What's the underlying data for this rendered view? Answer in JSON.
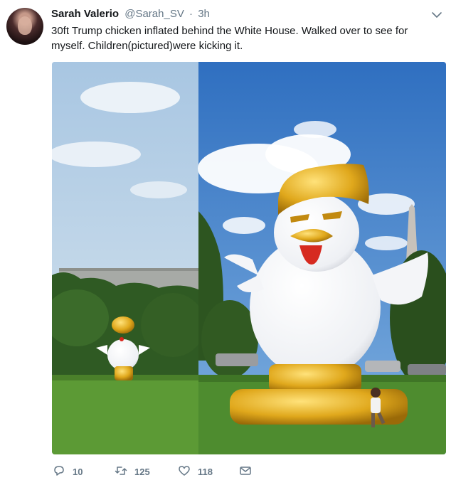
{
  "tweet": {
    "author_name": "Sarah Valerio",
    "handle": "@Sarah_SV",
    "separator": "·",
    "time": "3h",
    "text": "30ft Trump chicken inflated behind the White House. Walked over to see for myself. Children(pictured)were kicking it."
  },
  "media": {
    "description_icon": "photo-collage"
  },
  "actions": {
    "reply_count": "10",
    "retweet_count": "125",
    "like_count": "118"
  },
  "colors": {
    "text_primary": "#14171a",
    "text_secondary": "#657786",
    "sky": "#4f86c9",
    "grass": "#4e8c2f",
    "gold": "#e0a81c"
  }
}
